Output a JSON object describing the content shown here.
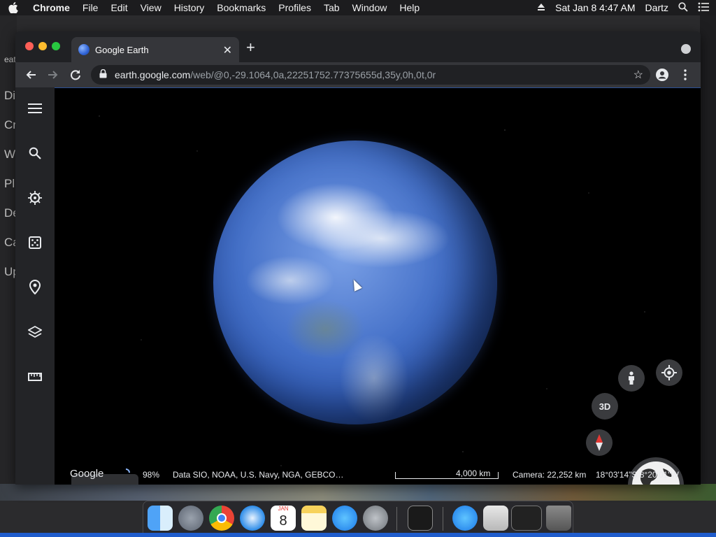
{
  "menubar": {
    "app_name": "Chrome",
    "items": [
      "File",
      "Edit",
      "View",
      "History",
      "Bookmarks",
      "Profiles",
      "Tab",
      "Window",
      "Help"
    ],
    "clock": "Sat Jan 8  4:47 AM",
    "user": "Dartz"
  },
  "background_window": {
    "fragments": [
      "eat",
      "Di",
      "Cr",
      "W",
      "Pl",
      "De",
      "Ca",
      "Up"
    ]
  },
  "browser": {
    "tab_title": "Google Earth",
    "new_tab": "+",
    "url_domain": "earth.google.com",
    "url_path": "/web/@0,-29.1064,0a,22251752.77375655d,35y,0h,0t,0r"
  },
  "earth": {
    "view_3d_label": "3D",
    "google_label": "Google",
    "loading_percent": "98%",
    "attribution": "Data SIO, NOAA, U.S. Navy, NGA, GEBCO…",
    "scale_label": "4,000 km",
    "camera": "Camera: 22,252 km",
    "coordinates": "18°03'14\"S 8°20'01\"W",
    "zoom_out": "−",
    "zoom_in": "+"
  },
  "colors": {
    "accent": "#1f5ccc",
    "viewport_bg": "#000000",
    "rail_bg": "#232427"
  },
  "dock": {
    "calendar_month": "JAN",
    "calendar_day": "8"
  }
}
